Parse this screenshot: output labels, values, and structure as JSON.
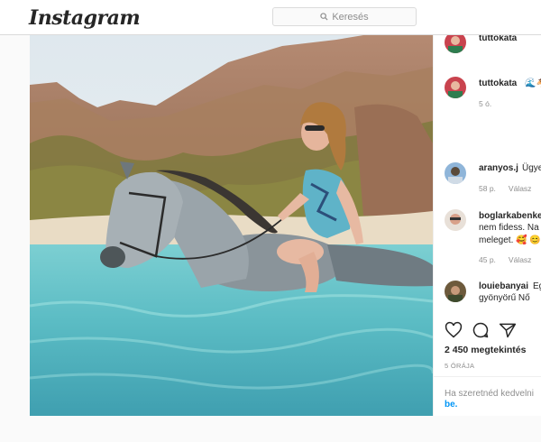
{
  "nav": {
    "logo": "Instagram",
    "search_placeholder": "Keresés"
  },
  "post": {
    "author": "tuttokata",
    "caption_author": "tuttokata",
    "caption_text": "🌊🐴",
    "caption_time": "5 ó."
  },
  "comments": [
    {
      "user": "aranyos.j",
      "text": "Ügyes",
      "time": "58 p.",
      "reply": "Válasz"
    },
    {
      "user": "boglarkabenke",
      "line2": "nem fidess. Na",
      "line3": "meleget. 🥰 😊",
      "time": "45 p.",
      "reply": "Válasz"
    },
    {
      "user": "louiebanyai",
      "text": "Eg",
      "line2": "gyönyörű Nő"
    }
  ],
  "footer": {
    "likes": "2 450 megtekintés",
    "time_ago": "5 ÓRÁJA",
    "login_prompt": "Ha szeretnéd kedvelni",
    "login_link": "be."
  },
  "icons": {
    "search": "search-icon",
    "like": "heart-icon",
    "comment": "comment-icon",
    "share": "share-icon"
  }
}
